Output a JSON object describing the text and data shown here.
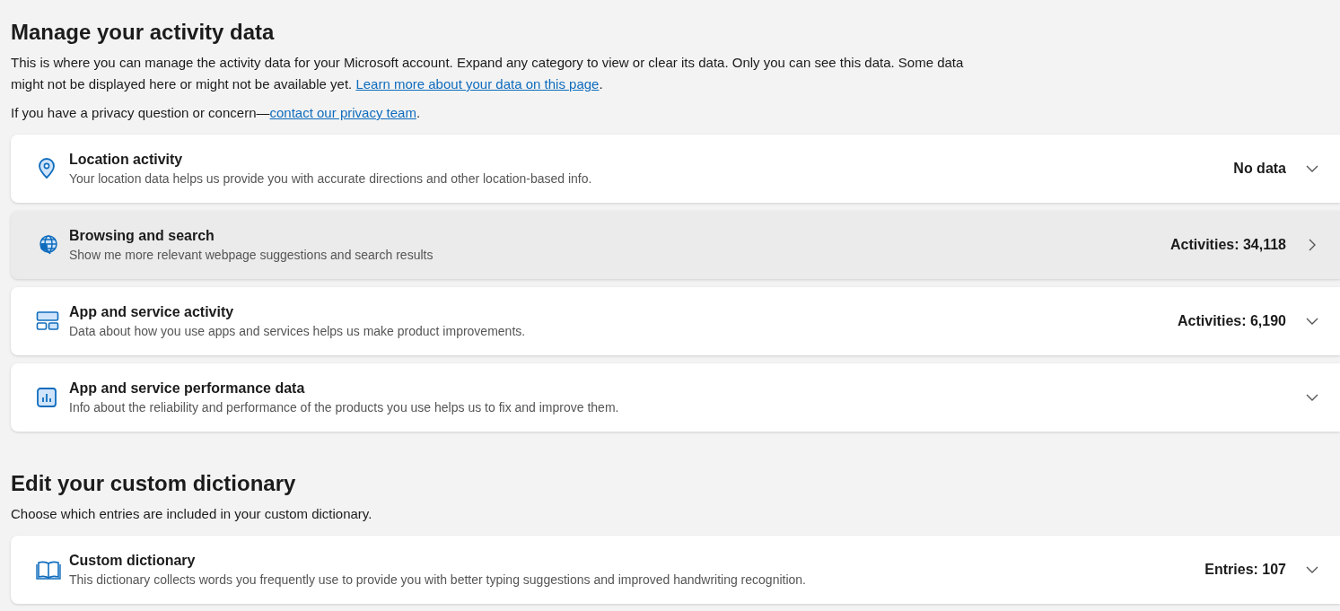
{
  "sections": [
    {
      "title": "Manage your activity data",
      "paragraphs": [
        {
          "text": "This is where you can manage the activity data for your Microsoft account. Expand any category to view or clear its data. Only you can see this data. Some data might not be displayed here or might not be available yet. ",
          "link": "Learn more about your data on this page",
          "after": "."
        },
        {
          "text": "If you have a privacy question or concern—",
          "link": "contact our privacy team",
          "after": "."
        }
      ],
      "items": [
        {
          "title": "Location activity",
          "description": "Your location data helps us provide you with accurate directions and other location-based info.",
          "value": "No data",
          "kind": "expand",
          "hovered": false
        },
        {
          "title": "Browsing and search",
          "description": "Show me more relevant webpage suggestions and search results",
          "value": "Activities: 34,118",
          "kind": "link",
          "hovered": true
        },
        {
          "title": "App and service activity",
          "description": "Data about how you use apps and services helps us make product improvements.",
          "value": "Activities: 6,190",
          "kind": "expand",
          "hovered": false
        },
        {
          "title": "App and service performance data",
          "description": "Info about the reliability and performance of the products you use helps us to fix and improve them.",
          "kind": "expand",
          "hovered": false
        }
      ]
    },
    {
      "title": "Edit your custom dictionary",
      "paragraphs": [
        {
          "text": "Choose which entries are included in your custom dictionary."
        }
      ],
      "items": [
        {
          "title": "Custom dictionary",
          "description": "This dictionary collects words you frequently use to provide you with better typing suggestions and improved handwriting recognition.",
          "value": "Entries: 107",
          "kind": "expand",
          "hovered": false
        }
      ]
    }
  ]
}
